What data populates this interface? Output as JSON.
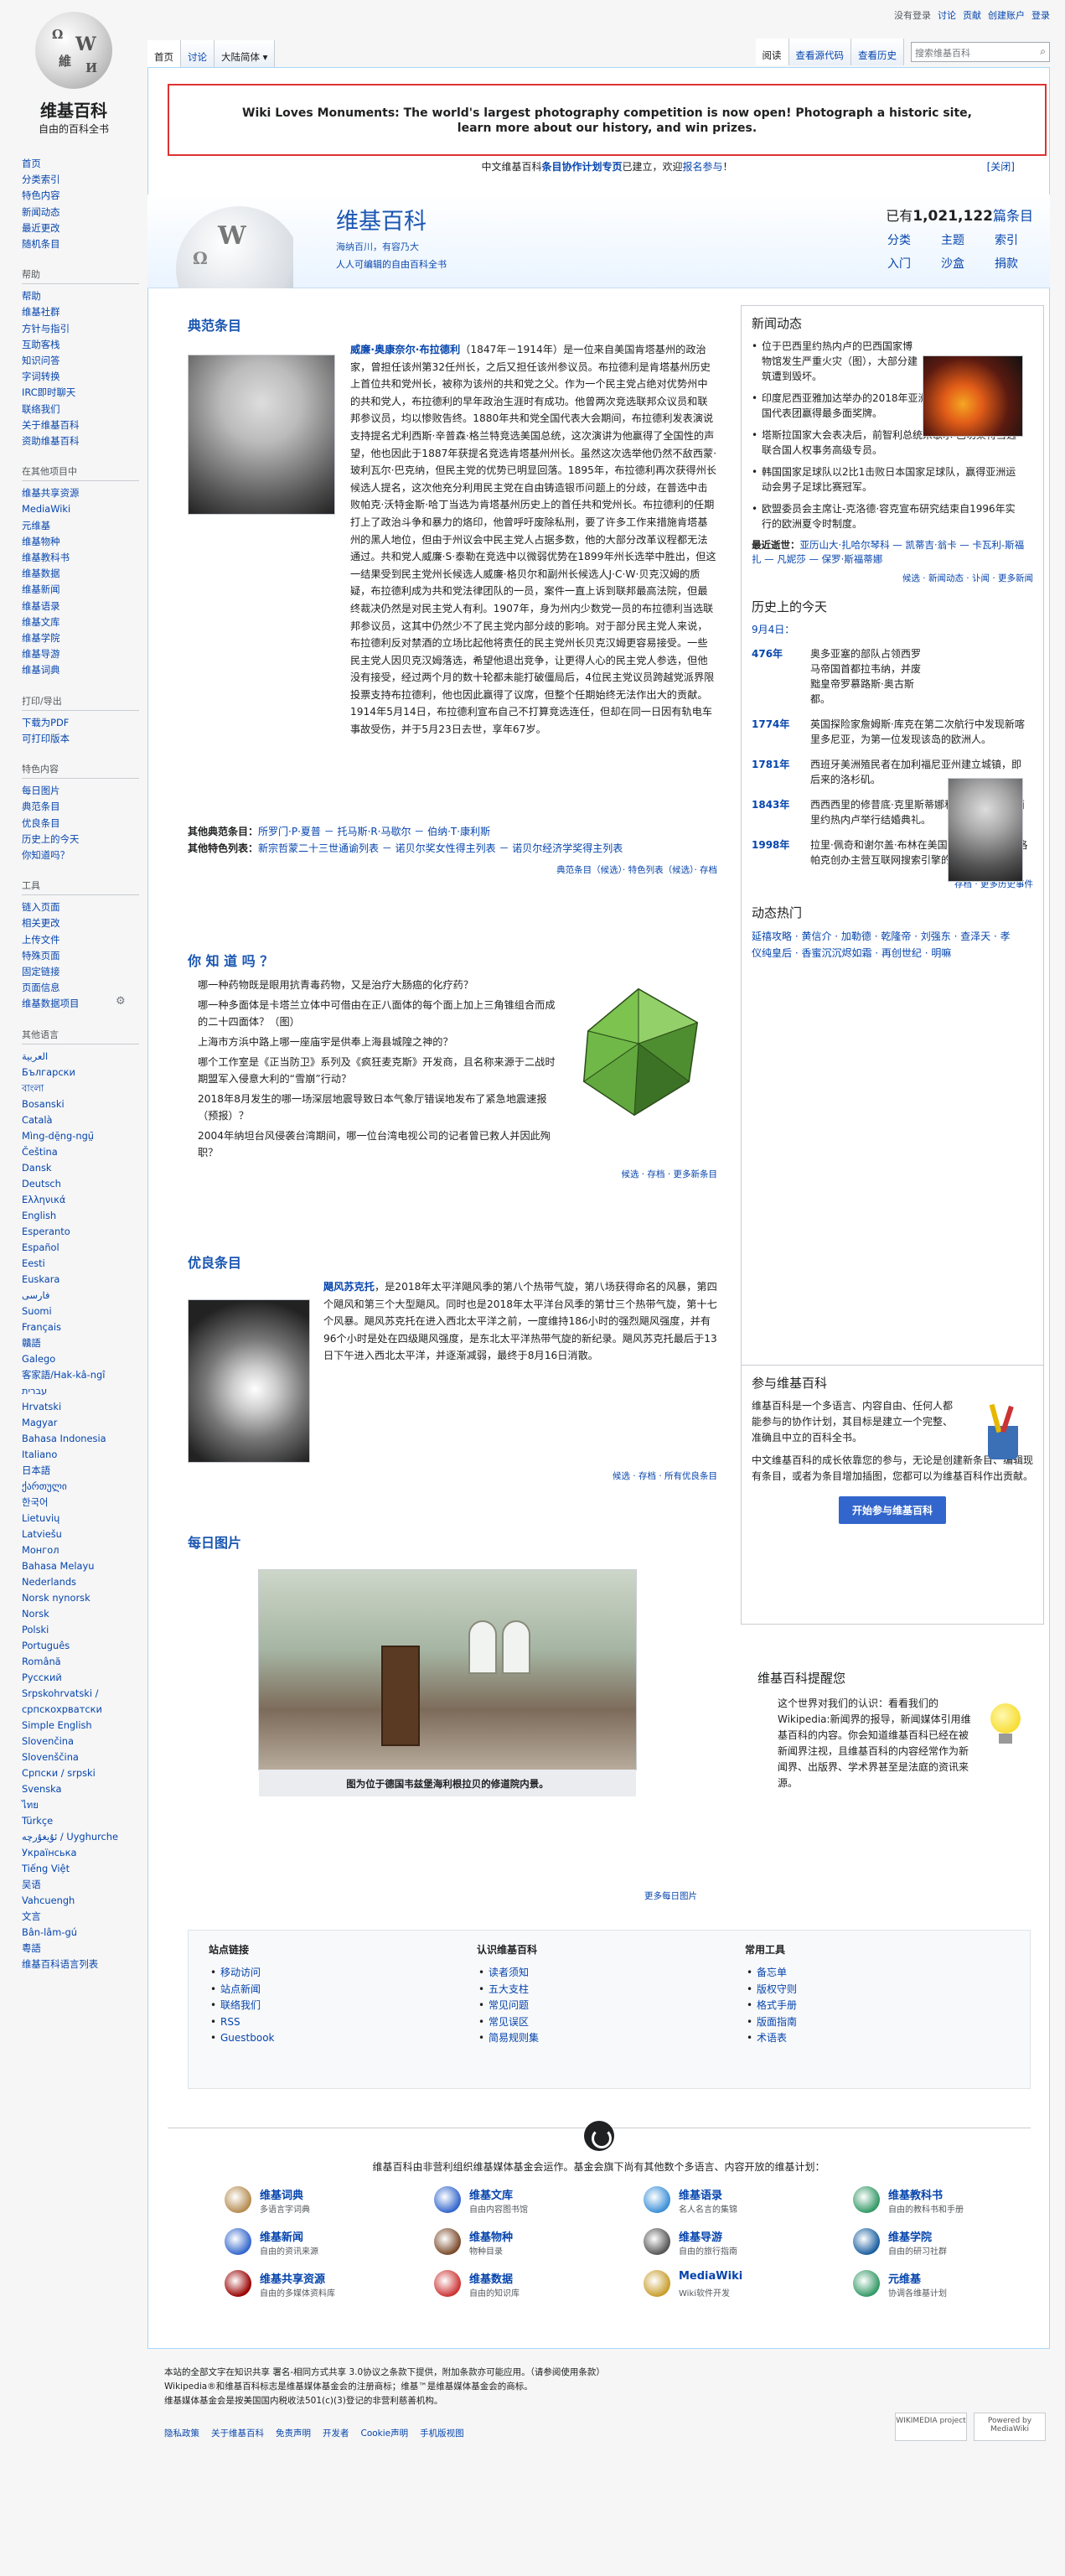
{
  "logo": {
    "title": "维基百科",
    "tagline": "自由的百科全书",
    "glyphs": [
      "Ω",
      "W",
      "維",
      "И"
    ]
  },
  "personal": {
    "not_logged": "没有登录",
    "talk": "讨论",
    "contrib": "贡献",
    "create": "创建账户",
    "login": "登录"
  },
  "tabs": {
    "home": "首页",
    "talk": "讨论",
    "variant": "大陆简体 ▾",
    "read": "阅读",
    "source": "查看源代码",
    "history": "查看历史"
  },
  "search": {
    "placeholder": "搜索维基百科"
  },
  "banner": {
    "line1": "Wiki Loves Monuments: The world's largest photography competition is now open! Photograph a historic site,",
    "line2": "learn more about our history, and win prizes."
  },
  "sitenotice": {
    "pre": "中文维基百科",
    "link1": "条目协作计划专页",
    "mid": "已建立，欢迎",
    "link2": "报名参与",
    "end": "！",
    "close": "[关闭]"
  },
  "welcome": {
    "title": "维基百科",
    "sub1": "海纳百川，有容乃大",
    "sub2": "人人可编辑的自由百科全书",
    "count_pre": "已有",
    "count": "1,021,122",
    "count_post": "篇条目",
    "nav": [
      "分类",
      "主题",
      "索引",
      "入门",
      "沙盒",
      "捐款"
    ]
  },
  "sidebar": {
    "nav": [
      "首页",
      "分类索引",
      "特色内容",
      "新闻动态",
      "最近更改",
      "随机条目"
    ],
    "help_h": "帮助",
    "help": [
      "帮助",
      "维基社群",
      "方针与指引",
      "互助客栈",
      "知识问答",
      "字词转换",
      "IRC即时聊天",
      "联络我们",
      "关于维基百科",
      "资助维基百科"
    ],
    "other_h": "在其他项目中",
    "other": [
      "维基共享资源",
      "MediaWiki",
      "元维基",
      "维基物种",
      "维基教科书",
      "维基数据",
      "维基新闻",
      "维基语录",
      "维基文库",
      "维基学院",
      "维基导游",
      "维基词典"
    ],
    "print_h": "打印/导出",
    "print": [
      "下载为PDF",
      "可打印版本"
    ],
    "special_h": "特色内容",
    "special": [
      "每日图片",
      "典范条目",
      "优良条目",
      "历史上的今天",
      "你知道吗？"
    ],
    "tools_h": "工具",
    "tools": [
      "链入页面",
      "相关更改",
      "上传文件",
      "特殊页面",
      "固定链接",
      "页面信息",
      "维基数据项目"
    ],
    "lang_h": "其他语言",
    "langs": [
      "العربية",
      "Български",
      "বাংলা",
      "Bosanski",
      "Català",
      "Mìng-dĕ̤ng-ngṳ̄",
      "Čeština",
      "Dansk",
      "Deutsch",
      "Ελληνικά",
      "English",
      "Esperanto",
      "Español",
      "Eesti",
      "Euskara",
      "فارسی",
      "Suomi",
      "Français",
      "贛語",
      "Galego",
      "客家語/Hak-kâ-ngî",
      "עברית",
      "Hrvatski",
      "Magyar",
      "Bahasa Indonesia",
      "Italiano",
      "日本語",
      "ქართული",
      "한국어",
      "Lietuvių",
      "Latviešu",
      "Монгол",
      "Bahasa Melayu",
      "Nederlands",
      "Norsk nynorsk",
      "Norsk",
      "Polski",
      "Português",
      "Română",
      "Русский",
      "Srpskohrvatski / српскохрватски",
      "Simple English",
      "Slovenčina",
      "Slovenščina",
      "Српски / srpski",
      "Svenska",
      "ไทย",
      "Türkçe",
      "ئۇيغۇرچە / Uyghurche",
      "Українська",
      "Tiếng Việt",
      "吴语",
      "Vahcuengh",
      "文言",
      "Bân-lâm-gú",
      "粵語",
      "维基百科语言列表"
    ]
  },
  "featured": {
    "heading": "典范条目",
    "p1_name": "威廉·奥康奈尔·布拉德利",
    "p1": "（1847年－1914年）是一位来自美国肯塔基州的政治家，曾担任该州第32任州长，之后又担任该州参议员。布拉德利是肯塔基州历史上首位共和党州长，被称为该州的共和党之父。作为一个民主党占绝对优势州中的共和党人，布拉德利的早年政治生涯时有成功。他曾两次竞选联邦众议员和联邦参议员，均以惨败告终。1880年共和党全国代表大会期间，布拉德利发表演说支持提名尤利西斯·辛普森·格兰特竞选美国总统，这次演讲为他赢得了全国性的声望，他也因此于1887年获提名竞选肯塔基州州长。虽然这次选举他仍然不敌西蒙·玻利瓦尔·巴克纳，但民主党的优势已明显回落。1895年，布拉德利再次获得州长候选人提名，这次他充分利用民主党在自由铸造银币问题上的分歧，在普选中击败帕克·沃特金斯·哈丁当选为肯塔基州历史上的首任共和党州长。布拉德利的任期打上了政治斗争和暴力的烙印，他曾呼吁废除私刑，要了许多工作来措施肯塔基州的黑人地位，但由于州议会中民主党人占据多数，他的大部分改革议程都无法通过。共和党人威廉·S·泰勒在竞选中以微弱优势在1899年州长选举中胜出，但这一结果受到民主党州长候选人威廉·格贝尔和副州长候选人J·C·W·贝克汉姆的质疑，布拉德利成为共和党法律团队的一员，案件一直上诉到联邦最高法院，但最终裁决仍然是对民主党人有利。1907年，身为州内少数党一员的布拉德利当选联邦参议员，这其中仍然少不了民主党内部分歧的影响。对于部分民主党人来说，布拉德利反对禁酒的立场比起他将责任的民主党州长贝克汉姆更容易接受。一些民主党人因贝克汉姆落选，希望他退出竞争，让更得人心的民主党人参选，但他没有接受，经过两个月的数十轮都未能打破僵局后，4位民主党议员跨越党派界限投票支持布拉德利，他也因此赢得了议席，但整个任期始终无法作出大的贡献。1914年5月14日，布拉德利宣布自己不打算竞选连任，但却在同一日因有轨电车事故受伤，并于5月23日去世，享年67岁。",
    "recent_label": "其他典范条目：",
    "recent": "所罗门·P·夏普 － 托马斯·R·马歇尔 － 伯纳·T·康利斯",
    "lists_label": "其他特色列表：",
    "lists": "新宗哲蒙二十三世通谕列表 － 诺贝尔奖女性得主列表 － 诺贝尔经济学奖得主列表",
    "more": "典范条目（候选）· 特色列表（候选）· 存档"
  },
  "dyk": {
    "heading": "你 知 道 吗 ？",
    "items": [
      "哪一种药物既是眼用抗青毒药物，又是治疗大肠癌的化疗药？",
      "哪一种多面体是卡塔兰立体中可借由在正八面体的每个面上加上三角锥组合而成的二十四面体？（图）",
      "上海市方浜中路上哪一座庙宇是供奉上海县城隍之神的？",
      "哪个工作室是《正当防卫》系列及《疯狂麦克斯》开发商，且名称来源于二战时期盟军入侵意大利的“雪崩”行动？",
      "2018年8月发生的哪一场深层地震导致日本气象厅错误地发布了紧急地震速报（预报）？",
      "2004年纳坦台风侵袭台湾期间，哪一位台湾电视公司的记者曾已救人并因此殉职？"
    ],
    "more": "候选 · 存档 · 更多新条目"
  },
  "ga": {
    "heading": "优良条目",
    "name": "飓风苏克托",
    "text": "，是2018年太平洋飓风季的第八个热带气旋，第八场获得命名的风暴，第四个飓风和第三个大型飓风。同时也是2018年太平洋台风季的第廿三个热带气旋，第十七个风暴。飓风苏克托在进入西北太平洋之前，一度维持186小时的强烈飓风强度，并有96个小时是处在四级飓风强度，是东北太平洋热带气旋的新纪录。飓风苏克托最后于13日下午进入西北太平洋，并逐渐减弱，最终于8月16日消散。",
    "more": "候选 · 存档 · 所有优良条目"
  },
  "potd": {
    "heading": "每日图片",
    "caption": "图为位于德国韦兹堡海利根拉贝的修道院内景。",
    "more": "更多每日图片"
  },
  "itn": {
    "heading": "新闻动态",
    "items": [
      "位于巴西里约热内卢的巴西国家博物馆发生严重火灾（图），大部分建筑遭到毁坏。",
      "印度尼西亚雅加达举办的2018年亚洲运动会闭幕式，由中国代表团赢得最多面奖牌。",
      "塔斯拉国家大会表决后，前智利总统米歇尔·巴切莱特当选联合国人权事务高级专员。",
      "韩国国家足球队以2比1击败日本国家足球队，赢得亚洲运动会男子足球比赛冠军。",
      "欧盟委员会主席让-克洛德·容克宣布研究结束自1996年实行的欧洲夏令时制度。"
    ],
    "recent_label": "最近逝世：",
    "recent": "亚历山大·扎哈尔琴科 — 凯蒂吉·翁卡 — 卡瓦利-斯福扎 — 凡妮莎 — 保罗·斯福蒂娜",
    "more": "候选 · 新闻动态 · 讣闻 · 更多新闻"
  },
  "otd": {
    "heading": "历史上的今天",
    "date": "9月4日：",
    "rows": [
      {
        "y": "476年",
        "t": "奥多亚塞的部队占领西罗马帝国首都拉韦纳，并废黜皇帝罗慕路斯·奥古斯都。"
      },
      {
        "y": "1774年",
        "t": "英国探险家詹姆斯·库克在第二次航行中发现新喀里多尼亚，为第一位发现该岛的欧洲人。"
      },
      {
        "y": "1781年",
        "t": "西班牙美洲殖民者在加利福尼亚州建立城镇，即后来的洛杉矶。"
      },
      {
        "y": "1843年",
        "t": "西西西里的修昔底·克里斯蒂娜和撒丁王国在巴西里约热内卢举行结婚典礼。"
      },
      {
        "y": "1998年",
        "t": "拉里·佩奇和谢尔盖·布林在美国加利福尼亚州门洛帕克创办主营互联网搜索引擎的Google公司。"
      }
    ],
    "more": "存档 · 更多历史事件"
  },
  "trending": {
    "heading": "动态热门",
    "text": "延禧攻略 · 黄信介 · 加勒德 · 乾隆帝 · 刘强东 · 查泽天 · 孝仪纯皇后 · 香蜜沉沉烬如霜 · 再创世纪 · 明嘛"
  },
  "join": {
    "heading": "参与维基百科",
    "p1": "维基百科是一个多语言、内容自由、任何人都能参与的协作计划，其目标是建立一个完整、准确且中立的百科全书。",
    "p2": "中文维基百科的成长依靠您的参与，无论是创建新条目、编辑现有条目，或者为条目增加插图，您都可以为维基百科作出贡献。",
    "button": "开始参与维基百科"
  },
  "reminder": {
    "heading": "维基百科提醒您",
    "text": "这个世界对我们的认识：看看我们的Wikipedia:新闻界的报导，新闻媒体引用维基百科的内容。你会知道维基百科已经在被新闻界注视，且维基百科的内容经常作为新闻界、出版界、学术界甚至是法庭的资讯来源。"
  },
  "portal": {
    "c1h": "站点链接",
    "c1": [
      "移动访问",
      "站点新闻",
      "联络我们",
      "RSS",
      "Guestbook"
    ],
    "c2h": "认识维基百科",
    "c2": [
      "读者须知",
      "五大支柱",
      "常见问题",
      "常见误区",
      "简易规则集"
    ],
    "c3h": "常用工具",
    "c3": [
      "备忘单",
      "版权守则",
      "格式手册",
      "版面指南",
      "术语表"
    ]
  },
  "wmf": {
    "intro": "维基百科由非营利组织维基媒体基金会运作。基金会旗下尚有其他数个多语言、内容开放的维基计划：",
    "projects": [
      {
        "n": "维基词典",
        "d": "多语言字词典"
      },
      {
        "n": "维基文库",
        "d": "自由内容图书馆"
      },
      {
        "n": "维基语录",
        "d": "名人名言的集锦"
      },
      {
        "n": "维基教科书",
        "d": "自由的教科书和手册"
      },
      {
        "n": "维基新闻",
        "d": "自由的资讯来源"
      },
      {
        "n": "维基物种",
        "d": "物种目录"
      },
      {
        "n": "维基导游",
        "d": "自由的旅行指南"
      },
      {
        "n": "维基学院",
        "d": "自由的研习社群"
      },
      {
        "n": "维基共享资源",
        "d": "自由的多媒体资料库"
      },
      {
        "n": "维基数据",
        "d": "自由的知识库"
      },
      {
        "n": "MediaWiki",
        "d": "Wiki软件开发"
      },
      {
        "n": "元维基",
        "d": "协调各维基计划"
      }
    ],
    "colors": [
      "#b58b4f",
      "#3366cc",
      "#3a8fd8",
      "#339966",
      "#3366cc",
      "#7a4a2a",
      "#555",
      "#1b5fa0",
      "#990000",
      "#cc3333",
      "#c89d2c",
      "#339966"
    ]
  },
  "footer": {
    "l1": "本站的全部文字在知识共享 署名-相同方式共享 3.0协议之条款下提供，附加条款亦可能应用。（请参阅使用条款）",
    "l2": "Wikipedia®和维基百科标志是维基媒体基金会的注册商标；维基™是维基媒体基金会的商标。",
    "l3": "维基媒体基金会是按美国国内税收法501(c)(3)登记的非营利慈善机构。",
    "links": [
      "隐私政策",
      "关于维基百科",
      "免责声明",
      "开发者",
      "Cookie声明",
      "手机版视图"
    ],
    "badge1": "WIKIMEDIA project",
    "badge2": "Powered by MediaWiki"
  }
}
